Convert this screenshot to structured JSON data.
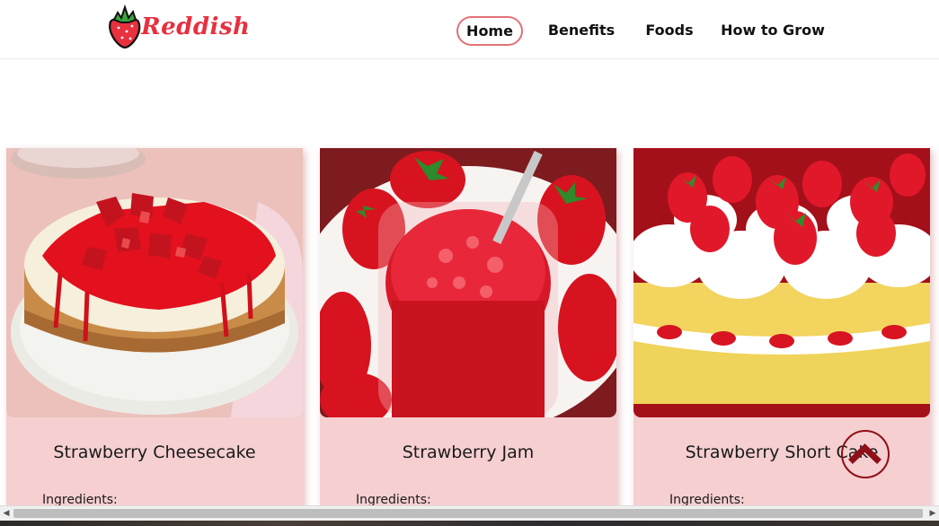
{
  "header": {
    "logo_text": "Reddish",
    "nav": [
      {
        "label": "Home",
        "active": true
      },
      {
        "label": "Benefits"
      },
      {
        "label": "Foods"
      },
      {
        "label": "How to Grow"
      }
    ]
  },
  "cards": [
    {
      "title": "Strawberry Cheesecake",
      "ingredients_label": "Ingredients:",
      "image": "strawberry-cheesecake-photo"
    },
    {
      "title": "Strawberry Jam",
      "ingredients_label": "Ingredients:",
      "image": "strawberry-jam-photo"
    },
    {
      "title": "Strawberry Short Cake",
      "ingredients_label": "Ingredients:",
      "image": "strawberry-shortcake-photo"
    }
  ],
  "icons": {
    "logo": "strawberry-icon",
    "back_to_top": "chevron-up-icon",
    "scroll_left": "arrow-left-icon",
    "scroll_right": "arrow-right-icon"
  },
  "colors": {
    "accent": "#e8303f",
    "card_bg": "#f6cfd1",
    "nav_active_border": "#e3707a",
    "back_to_top": "#8f0f17"
  }
}
